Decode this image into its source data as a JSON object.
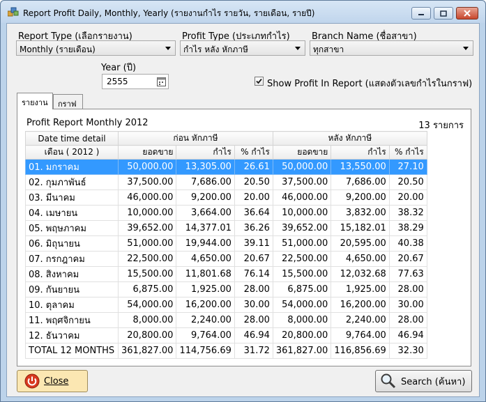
{
  "window": {
    "title": "Report Profit Daily, Monthly, Yearly (รายงานกำไร รายวัน, รายเดือน, รายปี)"
  },
  "filters": {
    "report_type_label": "Report Type (เลือกรายงาน)",
    "report_type_value": "Monthly (รายเดือน)",
    "profit_type_label": "Profit Type (ประเภทกำไร)",
    "profit_type_value": "กำไร หลัง หักภาษี",
    "branch_label": "Branch Name (ชื่อสาขา)",
    "branch_value": "ทุกสาขา",
    "year_label": "Year (ปี)",
    "year_value": "2555",
    "show_profit_label": "Show Profit In Report (แสดงตัวเลขกำไรในกราฟ)",
    "show_profit_checked": true
  },
  "tabs": [
    {
      "label": "รายงาน",
      "active": true
    },
    {
      "label": "กราฟ",
      "active": false
    }
  ],
  "report": {
    "title": "Profit Report Monthly 2012",
    "count": "13 รายการ",
    "header_top": {
      "col1": "Date time detail",
      "before_tax": "ก่อน หักภาษี",
      "after_tax": "หลัง หักภาษี"
    },
    "header_sub": [
      "เดือน ( 2012 )",
      "ยอดขาย",
      "กำไร",
      "% กำไร",
      "ยอดขาย",
      "กำไร",
      "% กำไร"
    ],
    "rows": [
      [
        "01. มกราคม",
        "50,000.00",
        "13,305.00",
        "26.61",
        "50,000.00",
        "13,550.00",
        "27.10"
      ],
      [
        "02. กุมภาพันธ์",
        "37,500.00",
        "7,686.00",
        "20.50",
        "37,500.00",
        "7,686.00",
        "20.50"
      ],
      [
        "03. มีนาคม",
        "46,000.00",
        "9,200.00",
        "20.00",
        "46,000.00",
        "9,200.00",
        "20.00"
      ],
      [
        "04. เมษายน",
        "10,000.00",
        "3,664.00",
        "36.64",
        "10,000.00",
        "3,832.00",
        "38.32"
      ],
      [
        "05. พฤษภาคม",
        "39,652.00",
        "14,377.01",
        "36.26",
        "39,652.00",
        "15,182.01",
        "38.29"
      ],
      [
        "06. มิถุนายน",
        "51,000.00",
        "19,944.00",
        "39.11",
        "51,000.00",
        "20,595.00",
        "40.38"
      ],
      [
        "07. กรกฎาคม",
        "22,500.00",
        "4,650.00",
        "20.67",
        "22,500.00",
        "4,650.00",
        "20.67"
      ],
      [
        "08. สิงหาคม",
        "15,500.00",
        "11,801.68",
        "76.14",
        "15,500.00",
        "12,032.68",
        "77.63"
      ],
      [
        "09. กันยายน",
        "6,875.00",
        "1,925.00",
        "28.00",
        "6,875.00",
        "1,925.00",
        "28.00"
      ],
      [
        "10. ตุลาคม",
        "54,000.00",
        "16,200.00",
        "30.00",
        "54,000.00",
        "16,200.00",
        "30.00"
      ],
      [
        "11. พฤศจิกายน",
        "8,000.00",
        "2,240.00",
        "28.00",
        "8,000.00",
        "2,240.00",
        "28.00"
      ],
      [
        "12. ธันวาคม",
        "20,800.00",
        "9,764.00",
        "46.94",
        "20,800.00",
        "9,764.00",
        "46.94"
      ],
      [
        "TOTAL 12 MONTHS",
        "361,827.00",
        "114,756.69",
        "31.72",
        "361,827.00",
        "116,856.69",
        "32.30"
      ]
    ],
    "selected_row": 0
  },
  "buttons": {
    "close_label": "Close",
    "search_label": "Search (ค้นหา)"
  }
}
